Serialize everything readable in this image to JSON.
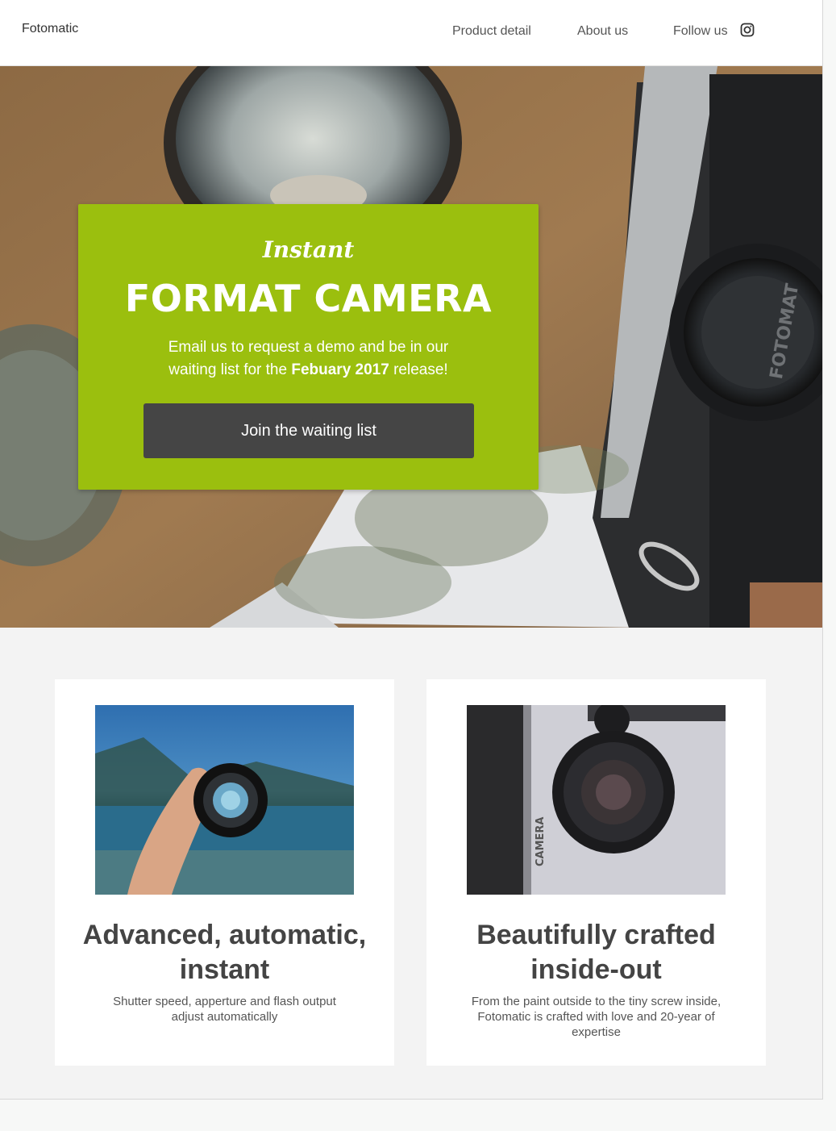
{
  "header": {
    "brand": "Fotomatic",
    "nav": {
      "product_detail": "Product detail",
      "about_us": "About us",
      "follow_us": "Follow us"
    },
    "follow_icon": "instagram-icon"
  },
  "hero": {
    "script_title": "Instant",
    "title": "FORMAT CAMERA",
    "description_before": "Email us to request a demo and be in our waiting list for the ",
    "description_bold": "Febuary 2017",
    "description_after": " release!",
    "cta_label": "Join the waiting list",
    "camera_text": "FOTOMAT",
    "accent_color": "#9bbf0e"
  },
  "features": [
    {
      "title": "Advanced, automatic, instant",
      "description": "Shutter speed, apperture and flash output adjust automatically"
    },
    {
      "title": "Beautifully crafted inside-out",
      "description": "From the paint outside to the tiny screw inside, Fotomatic is crafted with love and 20-year of expertise",
      "image_text": "CAMERA"
    }
  ]
}
